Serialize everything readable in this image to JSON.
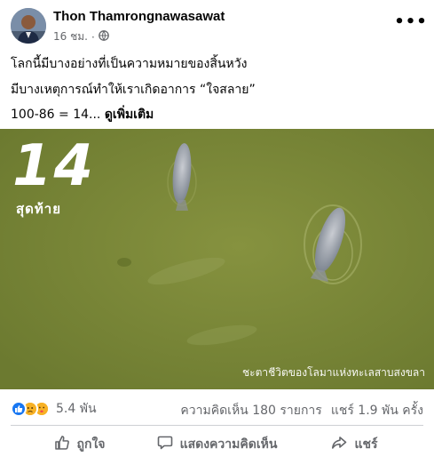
{
  "author": {
    "name": "Thon Thamrongnawasawat"
  },
  "meta": {
    "time": "16 ชม.",
    "separator": "·",
    "privacy_icon": "globe-icon"
  },
  "header": {
    "more_icon": "more-dots-icon",
    "more_label": "•••"
  },
  "post_text": {
    "line1": "โลกนี้มีบางอย่างที่เป็นความหมายของสิ้นหวัง",
    "line2": "มีบางเหตุการณ์ทำให้เราเกิดอาการ “ใจสลาย”",
    "line3": "100-86 = 14...",
    "see_more": "ดูเพิ่มเติม"
  },
  "image": {
    "big_number": "14",
    "label": "สุดท้าย",
    "caption": "ชะตาชีวิตของโลมาแห่งทะเลสาบสงขลา",
    "water_color": "#7d8a3a"
  },
  "stats": {
    "reaction_icons": [
      "like-icon",
      "sad-icon",
      "care-icon"
    ],
    "reaction_count": "5.4 พัน",
    "comments": "ความคิดเห็น 180 รายการ",
    "shares": "แชร์ 1.9 พัน ครั้ง"
  },
  "actions": {
    "like": "ถูกใจ",
    "comment": "แสดงความคิดเห็น",
    "share": "แชร์"
  },
  "colors": {
    "secondary_text": "#65676b",
    "like_blue": "#1877f2",
    "divider": "#ced0d4"
  }
}
